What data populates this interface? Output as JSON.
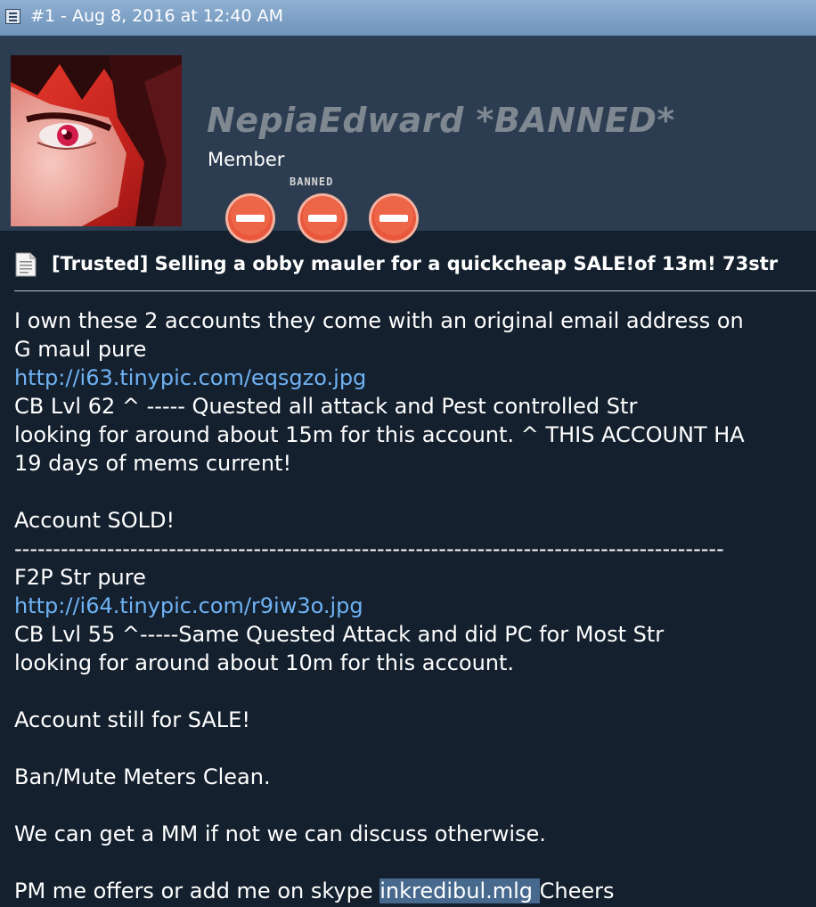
{
  "post_header": {
    "post_info": "#1 - Aug 8, 2016 at 12:40 AM",
    "icon": "post-icon"
  },
  "user": {
    "name": "NepiaEdward *BANNED*",
    "title": "Member",
    "badge_label": "BANNED",
    "badges": [
      "banned-icon",
      "banned-icon",
      "banned-icon"
    ],
    "avatar": "anime-avatar-image",
    "name_color": "#7f8791"
  },
  "thread": {
    "icon": "document-icon",
    "title": "[Trusted] Selling a obby mauler for a quickcheap SALE!of 13m! 73str"
  },
  "post": {
    "line1": "I own these 2 accounts they come with an original email address on",
    "line2": "G maul pure",
    "link1": "http://i63.tinypic.com/eqsgzo.jpg",
    "line4": "CB Lvl 62 ^ ----- Quested all attack and Pest controlled Str",
    "line5": "looking for around about 15m for this account. ^ THIS ACCOUNT HA",
    "line6": "19 days of mems current!",
    "line8": "Account SOLD!",
    "divider": "--------------------------------------------------------------------------------------------",
    "line10": "F2P Str pure",
    "link2": "http://i64.tinypic.com/r9iw3o.jpg",
    "line12": "CB Lvl 55 ^-----Same Quested Attack and did PC for Most Str",
    "line13": "looking for around about 10m for this account.",
    "line15": "Account still for SALE!",
    "line17": "Ban/Mute Meters Clean.",
    "line19": "We can get a MM if not we can discuss otherwise.",
    "line21_prefix": "PM me offers or add me on skype ",
    "skype": "inkredibul.mlg ",
    "line21_suffix": "Cheers"
  },
  "colors": {
    "background": "#14202e",
    "userbar": "#2c3d51",
    "link": "#6fb2f4",
    "badge": "#e9573c"
  }
}
